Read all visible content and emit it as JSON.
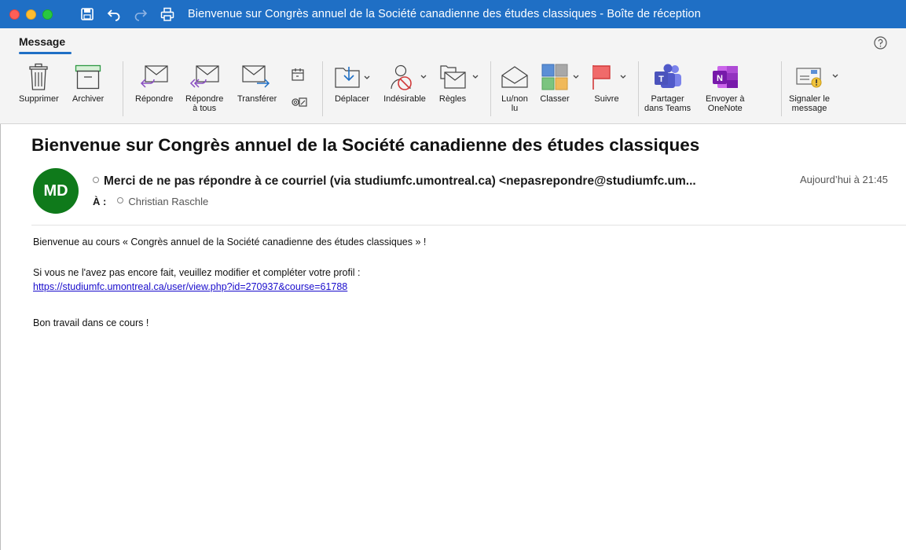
{
  "window": {
    "title": "Bienvenue sur Congrès annuel de la Société canadienne des études classiques - Boîte de réception",
    "titlebar_color": "#1f6fc5"
  },
  "ribbon": {
    "active_tab": "Message",
    "buttons": {
      "delete": "Supprimer",
      "archive": "Archiver",
      "reply": "Répondre",
      "reply_all_line1": "Répondre",
      "reply_all_line2": "à tous",
      "forward": "Transférer",
      "move": "Déplacer",
      "junk": "Indésirable",
      "rules": "Règles",
      "read_line1": "Lu/non",
      "read_line2": "lu",
      "categorize": "Classer",
      "follow": "Suivre",
      "teams_line1": "Partager",
      "teams_line2": "dans Teams",
      "onenote_line1": "Envoyer à",
      "onenote_line2": "OneNote",
      "report_line1": "Signaler le",
      "report_line2": "message"
    },
    "icons": {
      "teams_letter": "T",
      "onenote_letter": "N"
    }
  },
  "email": {
    "subject": "Bienvenue sur Congrès annuel de la Société canadienne des études classiques",
    "avatar_initials": "MD",
    "avatar_color": "#0f7a1b",
    "sender": "Merci de ne pas répondre à ce courriel  (via studiumfc.umontreal.ca) <nepasrepondre@studiumfc.um...",
    "to_label": "À :",
    "recipient": "Christian Raschle",
    "date": "Aujourd’hui à 21:45",
    "body": {
      "line1": "Bienvenue au cours « Congrès annuel de la Société canadienne des études classiques » !",
      "line2": "Si vous ne l'avez pas encore fait, veuillez modifier et compléter votre profil :",
      "link": "https://studiumfc.umontreal.ca/user/view.php?id=270937&course=61788",
      "line3": "Bon travail dans ce cours !"
    }
  }
}
